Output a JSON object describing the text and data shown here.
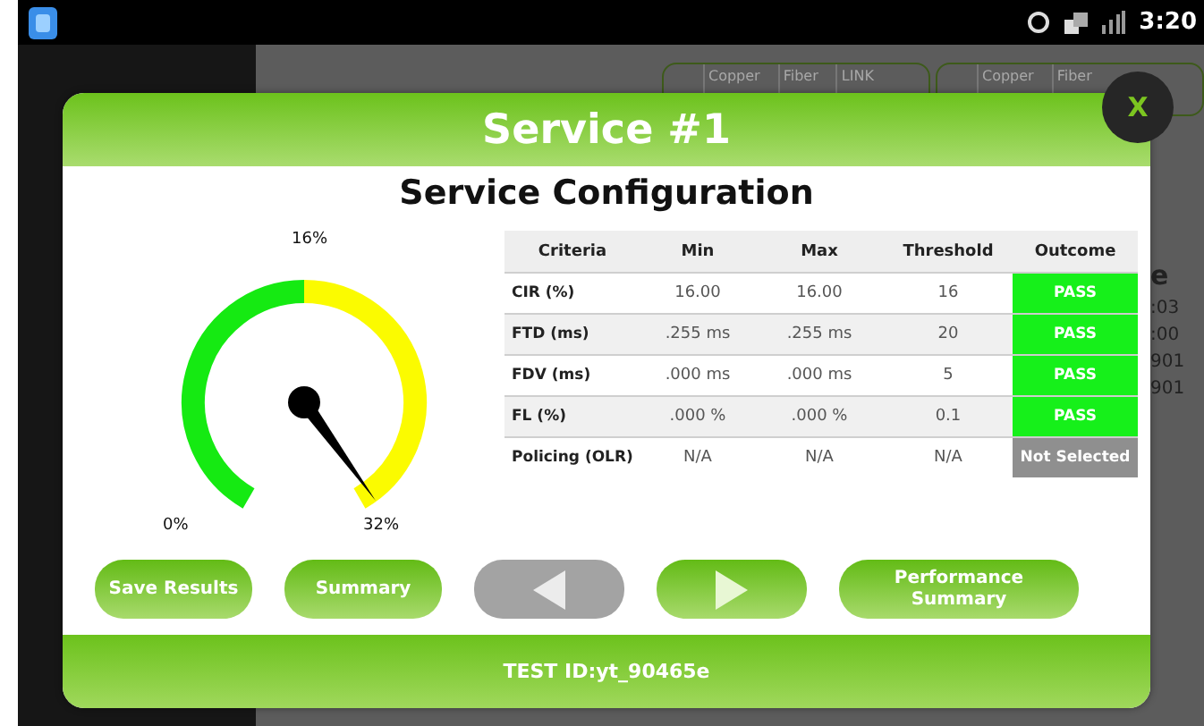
{
  "status_bar": {
    "time": "3:20"
  },
  "background": {
    "tab_groups": [
      [
        "Copper",
        "Fiber",
        "LINK"
      ],
      [
        "Copper",
        "Fiber"
      ]
    ],
    "side_texts": [
      "e",
      ":03",
      ":00",
      "901",
      "901"
    ]
  },
  "dialog": {
    "title": "Service #1",
    "close": "X",
    "heading": "Service Configuration",
    "gauge": {
      "labels": [
        "0%",
        "16%",
        "32%"
      ]
    },
    "table": {
      "columns": [
        "Criteria",
        "Min",
        "Max",
        "Threshold",
        "Outcome"
      ],
      "rows": [
        {
          "cells": [
            "CIR (%)",
            "16.00",
            "16.00",
            "16"
          ],
          "outcome": "PASS",
          "color": "#16f01a"
        },
        {
          "cells": [
            "FTD (ms)",
            ".255 ms",
            ".255 ms",
            "20"
          ],
          "outcome": "PASS",
          "color": "#16f01a"
        },
        {
          "cells": [
            "FDV (ms)",
            ".000 ms",
            ".000 ms",
            "5"
          ],
          "outcome": "PASS",
          "color": "#16f01a"
        },
        {
          "cells": [
            "FL (%)",
            ".000 %",
            ".000 %",
            "0.1"
          ],
          "outcome": "PASS",
          "color": "#16f01a"
        },
        {
          "cells": [
            "Policing (OLR)",
            "N/A",
            "N/A",
            "N/A"
          ],
          "outcome": "Not Selected",
          "color": "#8f8f8f"
        }
      ]
    },
    "buttons": [
      {
        "kind": "text",
        "label": "Save Results",
        "disabled": false
      },
      {
        "kind": "text",
        "label": "Summary",
        "disabled": false
      },
      {
        "kind": "prev",
        "disabled": true
      },
      {
        "kind": "next",
        "disabled": false
      },
      {
        "kind": "text",
        "label": "Performance Summary",
        "disabled": false
      }
    ],
    "footer": "TEST ID:yt_90465e"
  }
}
